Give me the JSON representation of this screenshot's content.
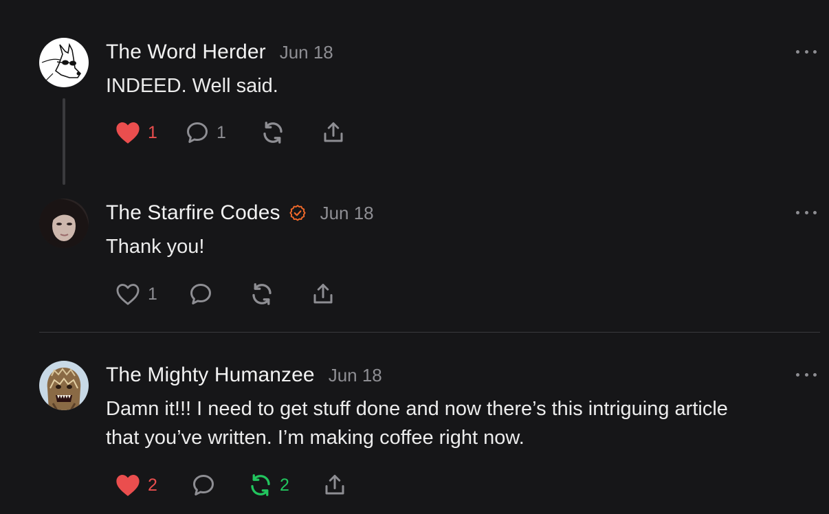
{
  "comments": [
    {
      "author": "The Word Herder",
      "date": "Jun 18",
      "text": "INDEED. Well said.",
      "likes": "1",
      "replies": "1",
      "restacks": "",
      "liked": true,
      "restacked": false,
      "avatar_icon": "dog-with-sunglasses-avatar"
    },
    {
      "author": "The Starfire Codes",
      "date": "Jun 18",
      "text": "Thank you!",
      "likes": "1",
      "replies": "",
      "restacks": "",
      "liked": false,
      "restacked": false,
      "verified": true,
      "avatar_icon": "woman-portrait-avatar"
    },
    {
      "author": "The Mighty Humanzee",
      "date": "Jun 18",
      "text_line1": "Damn it!!! I need to get stuff done and now there’s this intriguing article",
      "text_line2": "that you’ve written. I’m making coffee right now.",
      "likes": "2",
      "replies": "",
      "restacks": "2",
      "liked": true,
      "restacked": true,
      "avatar_icon": "creature-mask-avatar"
    }
  ],
  "colors": {
    "background": "#161618",
    "liked": "#ea4e4e",
    "restacked": "#22c55e",
    "verified": "#f0692a",
    "muted": "#8e8e93"
  }
}
